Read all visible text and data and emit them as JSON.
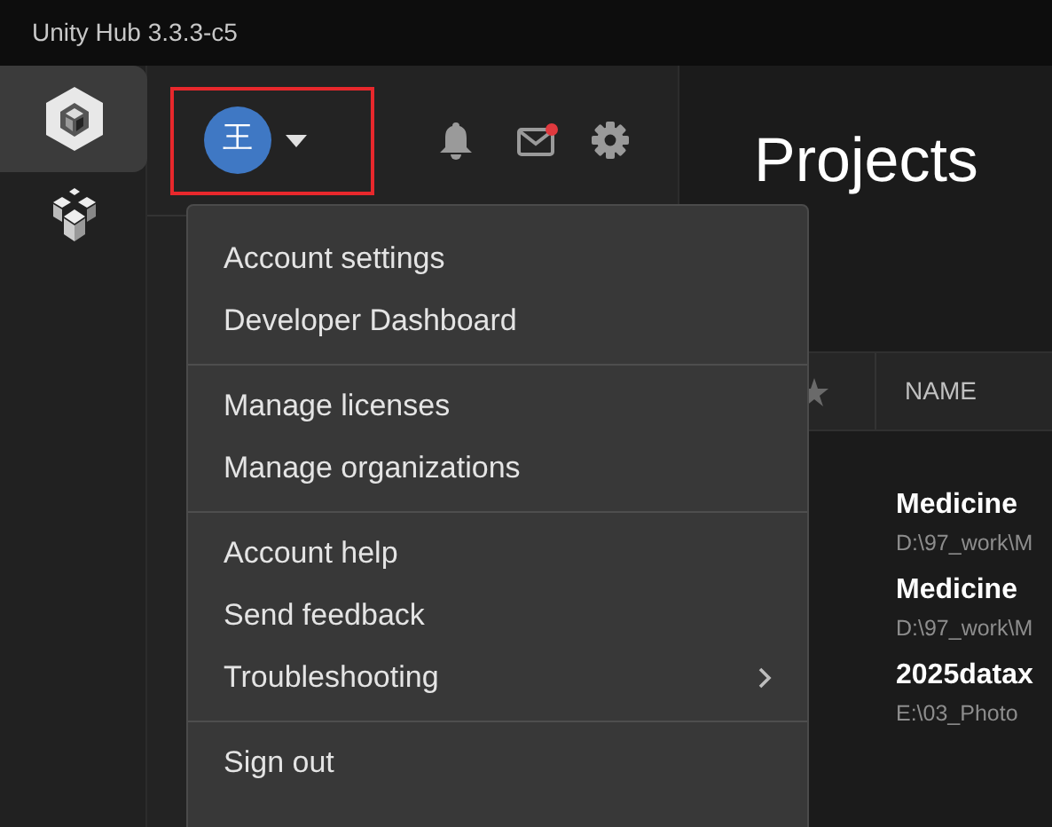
{
  "window": {
    "title": "Unity Hub 3.3.3-c5"
  },
  "rail": [
    {
      "kind": "projects",
      "selected": true
    },
    {
      "kind": "installs",
      "selected": false
    }
  ],
  "header": {
    "avatar": "王",
    "highlighted": true,
    "mail_unread": true
  },
  "menu": {
    "groups": [
      [
        {
          "label": "Account settings",
          "submenu": false
        },
        {
          "label": "Developer Dashboard",
          "submenu": false
        }
      ],
      [
        {
          "label": "Manage licenses",
          "submenu": false
        },
        {
          "label": "Manage organizations",
          "submenu": false
        }
      ],
      [
        {
          "label": "Account help",
          "submenu": false
        },
        {
          "label": "Send feedback",
          "submenu": false
        },
        {
          "label": "Troubleshooting",
          "submenu": true
        }
      ],
      [
        {
          "label": "Sign out",
          "submenu": false
        }
      ]
    ]
  },
  "page": {
    "title": "Projects"
  },
  "table": {
    "columns": [
      "NAME"
    ],
    "rows": [
      {
        "name": "Medicine",
        "path": "D:\\97_work\\M"
      },
      {
        "name": "Medicine",
        "path": "D:\\97_work\\M"
      },
      {
        "name": "2025datax",
        "path": "E:\\03_Photo"
      }
    ]
  }
}
